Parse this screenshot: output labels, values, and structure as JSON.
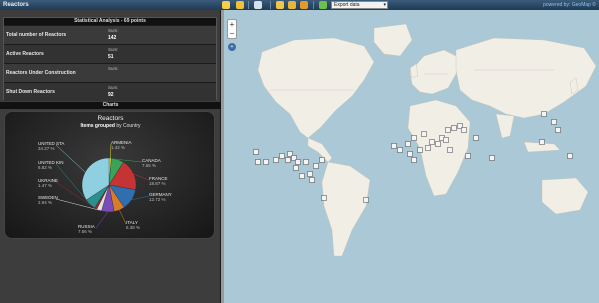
{
  "app": {
    "title": "Reactors",
    "attribution": "powered by: GeoMap ©"
  },
  "toolbar": {
    "tools": [
      {
        "name": "select-tool-icon",
        "color": "#f4d04a"
      },
      {
        "name": "comment-tool-icon",
        "color": "#f2c13a"
      },
      {
        "name": "filter-tool-icon",
        "color": "#d9e2ea"
      },
      {
        "name": "legend-tool-icon",
        "color": "#f0c64a"
      },
      {
        "name": "layers-tool-icon",
        "color": "#e8b43a"
      },
      {
        "name": "globe-tool-icon",
        "color": "#e39a2b"
      },
      {
        "name": "check-tool-icon",
        "color": "#6ec04e"
      }
    ],
    "export_select": "Export data"
  },
  "stats": {
    "header": "Statistical Analysis - 69 points",
    "rows": [
      {
        "label": "Total number of Reactors",
        "sum_label": "Sum:",
        "value": "142"
      },
      {
        "label": "Active Reactors",
        "sum_label": "Sum:",
        "value": "51"
      },
      {
        "label": "Reactors Under Construction",
        "sum_label": "Sum:",
        "value": ""
      },
      {
        "label": "Shut Down Reactors",
        "sum_label": "Sum:",
        "value": "92"
      }
    ]
  },
  "charts": {
    "bar_label": "Charts",
    "title": "Reactors",
    "subtitle_bold": "Items grouped",
    "subtitle_rest": " by Country"
  },
  "chart_data": {
    "type": "pie",
    "title": "Reactors",
    "subtitle": "Items grouped by Country",
    "slices": [
      {
        "label": "ARMENIA",
        "value": 1.42,
        "color": "#d8d830"
      },
      {
        "label": "CANADA",
        "value": 7.55,
        "color": "#3aa35a"
      },
      {
        "label": "FRANCE",
        "value": 18.87,
        "color": "#c43434"
      },
      {
        "label": "GERMANY",
        "value": 12.72,
        "color": "#2f6fb0"
      },
      {
        "label": "ITALY",
        "value": 6.38,
        "color": "#d87c2c"
      },
      {
        "label": "RUSSIA",
        "value": 7.56,
        "color": "#7a4bb8"
      },
      {
        "label": "SWEDEN",
        "value": 2.94,
        "color": "#e0e0e0"
      },
      {
        "label": "UKRAINE",
        "value": 1.47,
        "color": "#9a2a2a"
      },
      {
        "label": "UNITED KIN",
        "value": 6.82,
        "color": "#2a8f8f"
      },
      {
        "label": "UNITED STA",
        "value": 34.27,
        "color": "#8ed0df"
      }
    ],
    "display_pct": {
      "ARMENIA": "1.42 %",
      "CANADA": "7.55 %",
      "FRANCE": "18.87 %",
      "GERMANY": "12.72 %",
      "ITALY": "6.38 %",
      "RUSSIA": "7.56 %",
      "SWEDEN": "2.94 %",
      "UKRAINE": "1.47 %",
      "UNITED KIN": "6.82 %",
      "UNITED STA": "34.27 %"
    }
  },
  "map": {
    "zoom_in": "+",
    "zoom_out": "−",
    "layer_switcher": "+",
    "ocean_color": "#aac8d6",
    "land_color": "#f1eee6"
  }
}
